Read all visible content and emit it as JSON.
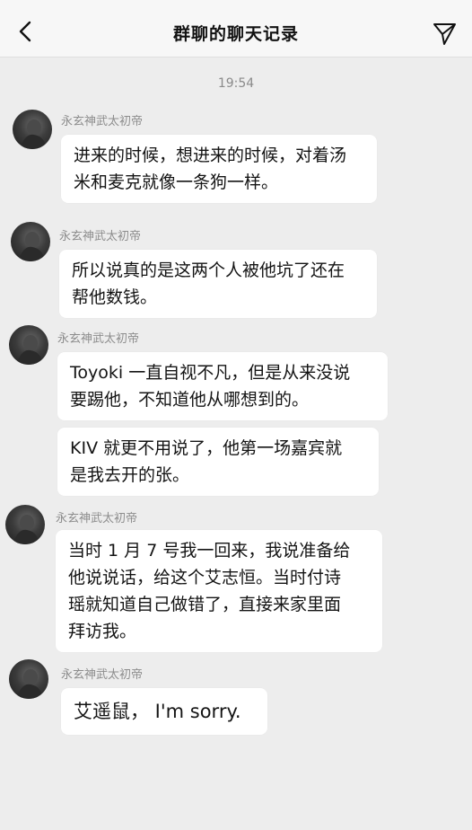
{
  "header": {
    "title": "群聊的聊天记录",
    "back_icon": "chevron-left-icon",
    "share_icon": "send-icon"
  },
  "timestamp": "19:54",
  "messages": [
    {
      "sender": "永玄神武太初帝",
      "text": "进来的时候，想进来的时候，对着汤\n米和麦克就像一条狗一样。"
    },
    {
      "sender": "永玄神武太初帝",
      "text": "所以说真的是这两个人被他坑了还在\n帮他数钱。"
    },
    {
      "sender": "永玄神武太初帝",
      "text": "Toyoki 一直自视不凡，但是从来没说\n要踢他，不知道他从哪想到的。"
    },
    {
      "sender": "",
      "text": "KIV 就更不用说了，他第一场嘉宾就\n是我去开的张。"
    },
    {
      "sender": "永玄神武太初帝",
      "text": "当时 1 月 7 号我一回来，我说准备给\n他说说话，给这个艾志恒。当时付诗\n瑶就知道自己做错了，直接来家里面\n拜访我。"
    },
    {
      "sender": "永玄神武太初帝",
      "text": "艾遥鼠， I'm sorry."
    }
  ]
}
